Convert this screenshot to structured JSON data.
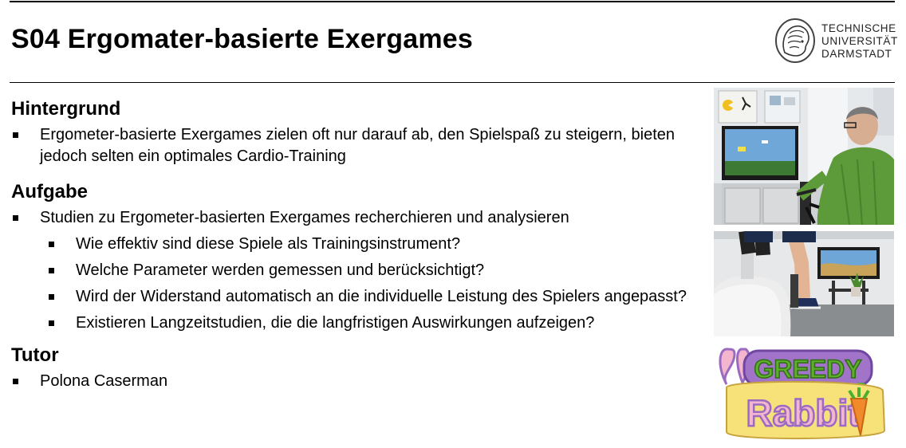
{
  "header": {
    "title": "S04 Ergomater-basierte Exergames",
    "logo_lines": [
      "TECHNISCHE",
      "UNIVERSITÄT",
      "DARMSTADT"
    ]
  },
  "sections": {
    "hintergrund": {
      "heading": "Hintergrund",
      "bullets": [
        "Ergometer-basierte Exergames zielen oft nur darauf ab, den Spielspaß zu steigern, bieten jedoch selten ein optimales Cardio-Training"
      ]
    },
    "aufgabe": {
      "heading": "Aufgabe",
      "bullet": "Studien zu Ergometer-basierten Exergames recherchieren und analysieren",
      "sub_bullets": [
        "Wie effektiv sind diese Spiele als Trainingsinstrument?",
        "Welche Parameter werden gemessen und berücksichtigt?",
        "Wird der Widerstand automatisch an die individuelle Leistung des Spielers angepasst?",
        "Existieren Langzeitstudien, die die langfristigen Auswirkungen aufzeigen?"
      ]
    },
    "tutor": {
      "heading": "Tutor",
      "bullets": [
        "Polona Caserman"
      ]
    }
  },
  "images": {
    "game_logo_text": [
      "GREEDY",
      "Rabbit"
    ]
  },
  "colors": {
    "text": "#000000",
    "wall": "#e9ecee",
    "shirt_green": "#5c9a3a",
    "rabbit_pink": "#f4b6cf",
    "rabbit_purple": "#9b6bc2",
    "greedy_green": "#5fae2e"
  }
}
